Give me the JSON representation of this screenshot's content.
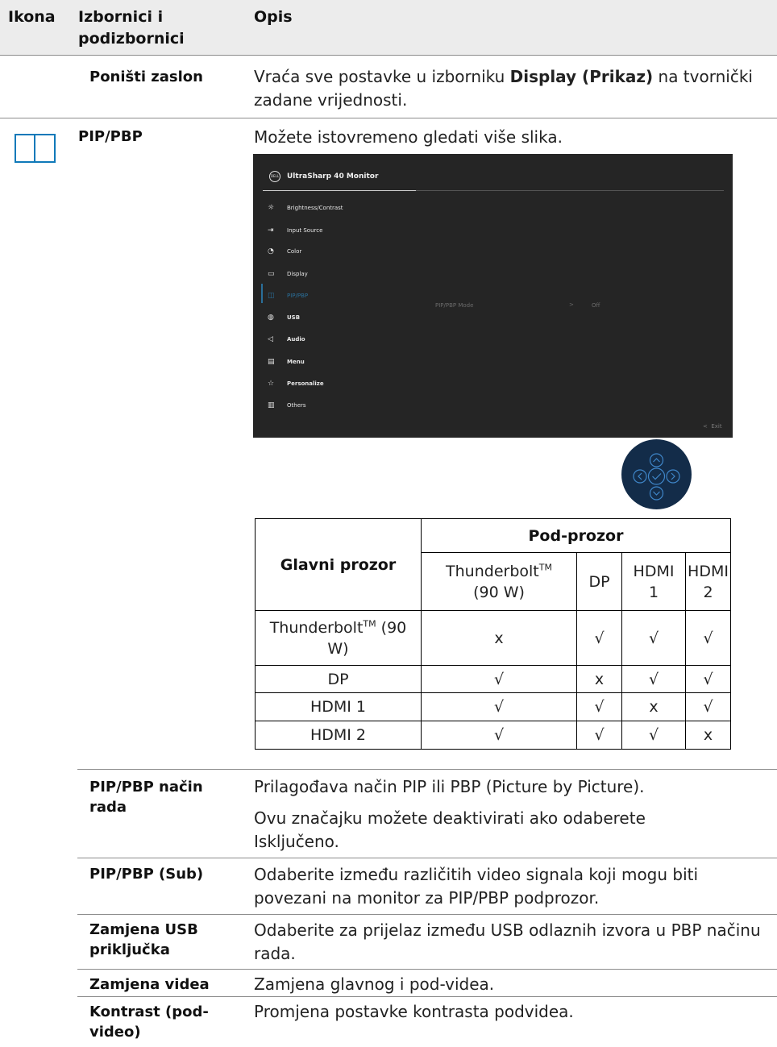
{
  "header": {
    "col_icon": "Ikona",
    "col_menus": "Izbornici i podizbornici",
    "col_desc": "Opis"
  },
  "rows": {
    "reset": {
      "name": "Poništi zaslon",
      "desc_pre": "Vraća sve postavke u izborniku ",
      "desc_bold": "Display (Prikaz)",
      "desc_post": " na tvornički zadane vrijednosti."
    },
    "pip": {
      "name": "PIP/PBP",
      "desc": "Možete istovremeno gledati više slika.",
      "icon": "pip-pbp-icon"
    },
    "pip_mode": {
      "name": "PIP/PBP način rada",
      "desc1": "Prilagođava način PIP ili PBP (Picture by Picture).",
      "desc2": "Ovu značajku možete deaktivirati ako odaberete Isključeno."
    },
    "pip_sub": {
      "name": "PIP/PBP (Sub)",
      "desc": "Odaberite između različitih video signala koji mogu biti povezani na monitor za PIP/PBP podprozor."
    },
    "usb_swap": {
      "name": "Zamjena USB priključka",
      "desc": "Odaberite za prijelaz između USB odlaznih izvora u PBP načinu rada."
    },
    "video_swap": {
      "name": "Zamjena videa",
      "desc": "Zamjena glavnog i pod-videa."
    },
    "contrast": {
      "name": "Kontrast (pod-video)",
      "desc": "Promjena postavke kontrasta podvidea."
    }
  },
  "osd": {
    "logo": "DELL",
    "title": "UltraSharp 40 Monitor",
    "menu": [
      {
        "label": "Brightness/Contrast",
        "icon": "sun-icon",
        "glyph": "☼"
      },
      {
        "label": "Input Source",
        "icon": "input-source-icon",
        "glyph": "⇥"
      },
      {
        "label": "Color",
        "icon": "color-palette-icon",
        "glyph": "◔"
      },
      {
        "label": "Display",
        "icon": "monitor-icon",
        "glyph": "▭"
      },
      {
        "label": "PIP/PBP",
        "icon": "pip-pbp-icon",
        "glyph": "◫"
      },
      {
        "label": "USB",
        "icon": "mouse-icon",
        "glyph": "◍"
      },
      {
        "label": "Audio",
        "icon": "speaker-icon",
        "glyph": "◁"
      },
      {
        "label": "Menu",
        "icon": "menu-icon",
        "glyph": "▤"
      },
      {
        "label": "Personalize",
        "icon": "star-icon",
        "glyph": "☆"
      },
      {
        "label": "Others",
        "icon": "others-icon",
        "glyph": "▥"
      }
    ],
    "selected_index": 4,
    "mode_label": "PIP/PBP Mode",
    "mode_arrow": ">",
    "mode_value": "Off",
    "exit_label": "Exit",
    "exit_arrow": "<",
    "accent_color": "#2a6f9a"
  },
  "joystick": {
    "color": "#132c49",
    "icons": [
      "chevron-up-icon",
      "chevron-left-icon",
      "check-icon",
      "chevron-right-icon",
      "chevron-down-icon"
    ]
  },
  "matrix": {
    "main_header": "Glavni prozor",
    "sub_header": "Pod-prozor",
    "tm": "TM",
    "sub_cols": [
      {
        "l1": "Thunderbolt",
        "tm": true,
        "l2": "(90 W)"
      },
      {
        "l1": "DP",
        "tm": false,
        "l2": ""
      },
      {
        "l1": "HDMI",
        "tm": false,
        "l2": "1"
      },
      {
        "l1": "HDMI",
        "tm": false,
        "l2": "2"
      }
    ],
    "rows": [
      {
        "main_l1": "Thunderbolt",
        "tm": true,
        "main_post": " (90",
        "main_l2": "W)",
        "cells": [
          "x",
          "√",
          "√",
          "√"
        ]
      },
      {
        "main_l1": "DP",
        "tm": false,
        "main_post": "",
        "main_l2": "",
        "cells": [
          "√",
          "x",
          "√",
          "√"
        ]
      },
      {
        "main_l1": "HDMI 1",
        "tm": false,
        "main_post": "",
        "main_l2": "",
        "cells": [
          "√",
          "√",
          "x",
          "√"
        ]
      },
      {
        "main_l1": "HDMI 2",
        "tm": false,
        "main_post": "",
        "main_l2": "",
        "cells": [
          "√",
          "√",
          "√",
          "x"
        ]
      }
    ]
  }
}
